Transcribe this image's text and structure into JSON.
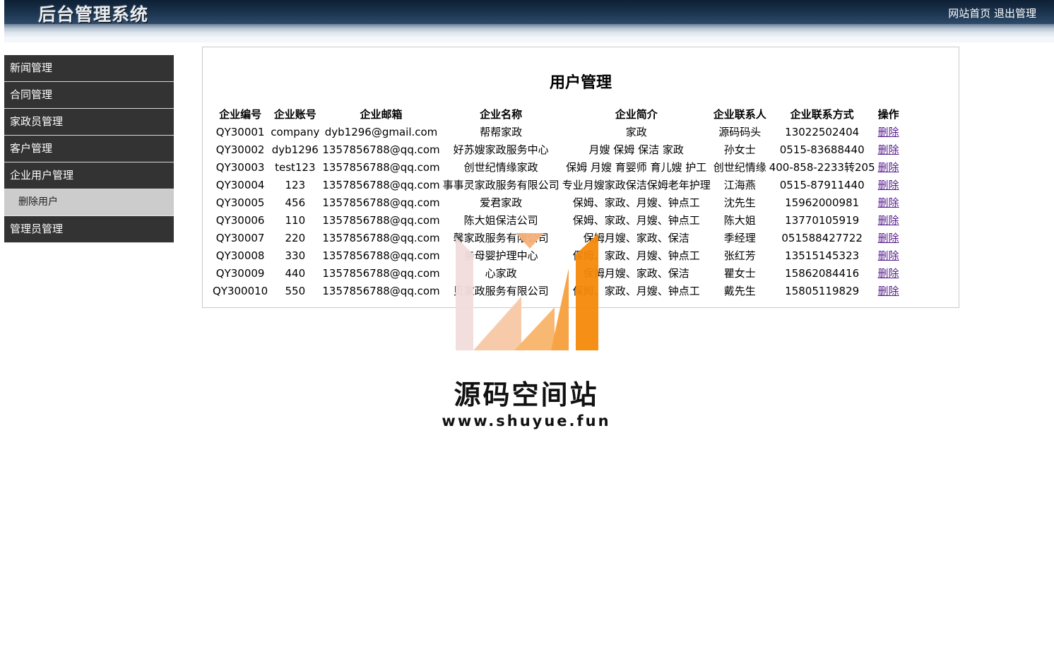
{
  "header": {
    "brand": "后台管理系统",
    "links": [
      "网站首页",
      "退出管理"
    ]
  },
  "sidebar": {
    "items": [
      {
        "label": "新闻管理"
      },
      {
        "label": "合同管理"
      },
      {
        "label": "家政员管理"
      },
      {
        "label": "客户管理"
      },
      {
        "label": "企业用户管理"
      },
      {
        "label": "删除用户",
        "sub": true
      },
      {
        "label": "管理员管理"
      }
    ]
  },
  "main": {
    "title": "用户管理",
    "columns": [
      "企业编号",
      "企业账号",
      "企业邮箱",
      "企业名称",
      "企业简介",
      "企业联系人",
      "企业联系方式",
      "操作"
    ],
    "rows": [
      [
        "QY30001",
        "company",
        "dyb1296@gmail.com",
        "帮帮家政",
        "家政",
        "源码码头",
        "13022502404",
        "删除"
      ],
      [
        "QY30002",
        "dyb1296",
        "1357856788@qq.com",
        "好苏嫂家政服务中心",
        "月嫂 保姆 保洁 家政",
        "孙女士",
        "0515-83688440",
        "删除"
      ],
      [
        "QY30003",
        "test123",
        "1357856788@qq.com",
        "创世纪情缘家政",
        "保姆 月嫂 育婴师 育儿嫂 护工",
        "创世纪情缘",
        "400-858-2233转205",
        "删除"
      ],
      [
        "QY30004",
        "123",
        "1357856788@qq.com",
        "事事灵家政服务有限公司",
        "专业月嫂家政保洁保姆老年护理",
        "江海燕",
        "0515-87911440",
        "删除"
      ],
      [
        "QY30005",
        "456",
        "1357856788@qq.com",
        "爱君家政",
        "保姆、家政、月嫂、钟点工",
        "沈先生",
        "15962000981",
        "删除"
      ],
      [
        "QY30006",
        "110",
        "1357856788@qq.com",
        "陈大姐保洁公司",
        "保姆、家政、月嫂、钟点工",
        "陈大姐",
        "13770105919",
        "删除"
      ],
      [
        "QY30007",
        "220",
        "1357856788@qq.com",
        "馨家政服务有限公司",
        "保姆月嫂、家政、保洁",
        "季经理",
        "051588427722",
        "删除"
      ],
      [
        "QY30008",
        "330",
        "1357856788@qq.com",
        "亲母婴护理中心",
        "保姆、家政、月嫂、钟点工",
        "张红芳",
        "13515145323",
        "删除"
      ],
      [
        "QY30009",
        "440",
        "1357856788@qq.com",
        "心家政",
        "保姆月嫂、家政、保洁",
        "瞿女士",
        "15862084416",
        "删除"
      ],
      [
        "QY300010",
        "550",
        "1357856788@qq.com",
        "贝家政服务有限公司",
        "保姆、家政、月嫂、钟点工",
        "戴先生",
        "15805119829",
        "删除"
      ]
    ]
  },
  "watermark": {
    "title": "源码空间站",
    "url": "www.shuyue.fun",
    "colors": [
      "#f3dddd",
      "#f7c9a6",
      "#f9b56a",
      "#f7a03e",
      "#f58a0a"
    ]
  }
}
